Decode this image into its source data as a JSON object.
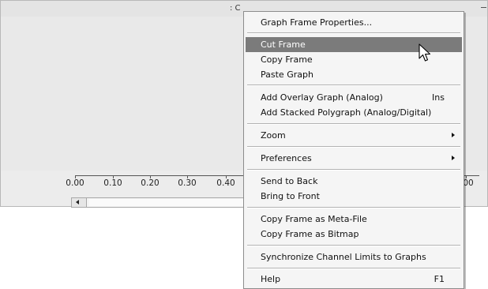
{
  "graph": {
    "title_fragment": ": C",
    "x_axis_ticks": [
      "0.00",
      "0.10",
      "0.20",
      "0.30",
      "0.40",
      "00"
    ]
  },
  "context_menu": {
    "items": [
      {
        "label": "Graph Frame Properties..."
      },
      {
        "label": "Cut Frame",
        "highlighted": true
      },
      {
        "label": "Copy Frame"
      },
      {
        "label": "Paste Graph"
      },
      {
        "label": "Add Overlay Graph (Analog)",
        "shortcut": "Ins"
      },
      {
        "label": "Add Stacked Polygraph (Analog/Digital)"
      },
      {
        "label": "Zoom",
        "submenu": true
      },
      {
        "label": "Preferences",
        "submenu": true
      },
      {
        "label": "Send to Back"
      },
      {
        "label": "Bring to Front"
      },
      {
        "label": "Copy Frame as Meta-File"
      },
      {
        "label": "Copy Frame as Bitmap"
      },
      {
        "label": "Synchronize Channel Limits to Graphs"
      },
      {
        "label": "Help",
        "shortcut": "F1"
      }
    ]
  },
  "colors": {
    "highlight": "#7b7b7b",
    "menu_background": "#f5f5f5",
    "graph_background": "#e9e9e9"
  },
  "icons": {
    "scroll_left": "scroll-left-arrow-icon",
    "submenu": "submenu-arrow-icon",
    "cursor": "mouse-pointer-icon"
  }
}
